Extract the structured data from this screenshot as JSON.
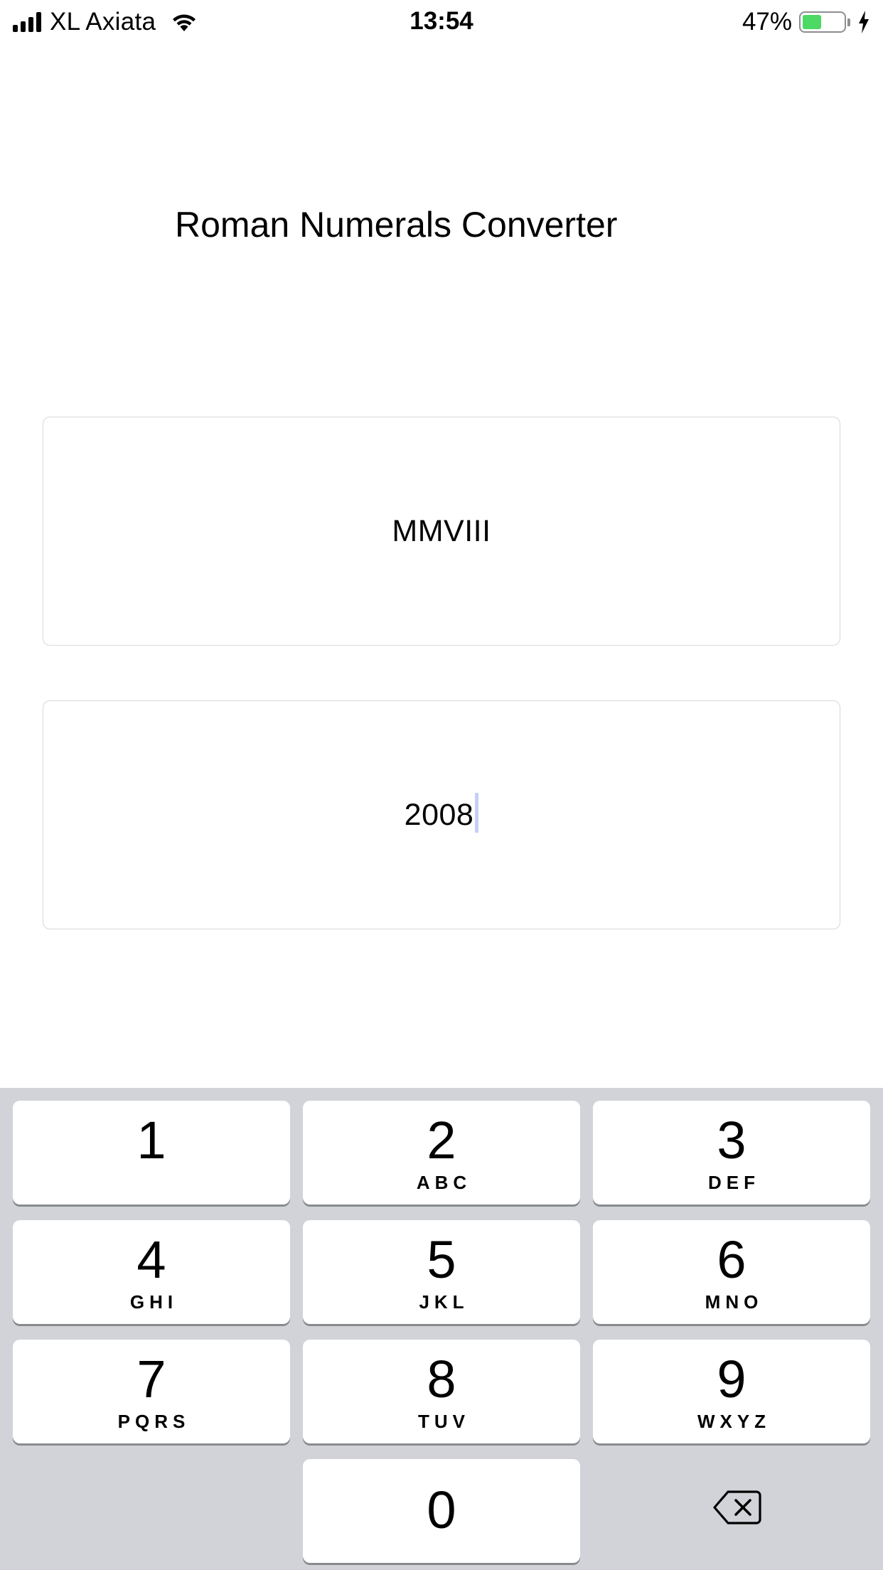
{
  "status_bar": {
    "carrier": "XL Axiata",
    "time": "13:54",
    "battery_percent": "47%",
    "battery_level": 0.47,
    "charging": true,
    "icons": [
      "signal-bars-icon",
      "wifi-icon",
      "battery-icon",
      "charging-bolt-icon"
    ]
  },
  "app": {
    "title": "Roman Numerals Converter"
  },
  "roman_field": {
    "value": "MMVIII"
  },
  "number_field": {
    "value": "2008",
    "focused": true
  },
  "keypad": {
    "keys": [
      {
        "digit": "1",
        "letters": ""
      },
      {
        "digit": "2",
        "letters": "ABC"
      },
      {
        "digit": "3",
        "letters": "DEF"
      },
      {
        "digit": "4",
        "letters": "GHI"
      },
      {
        "digit": "5",
        "letters": "JKL"
      },
      {
        "digit": "6",
        "letters": "MNO"
      },
      {
        "digit": "7",
        "letters": "PQRS"
      },
      {
        "digit": "8",
        "letters": "TUV"
      },
      {
        "digit": "9",
        "letters": "WXYZ"
      },
      {
        "digit": "0",
        "letters": ""
      }
    ],
    "delete_icon": "backspace-icon"
  },
  "colors": {
    "keyboard_background": "#d1d3d9",
    "key_background": "#ffffff",
    "battery_fill": "#4cd964",
    "caret": "#c6cff5"
  }
}
